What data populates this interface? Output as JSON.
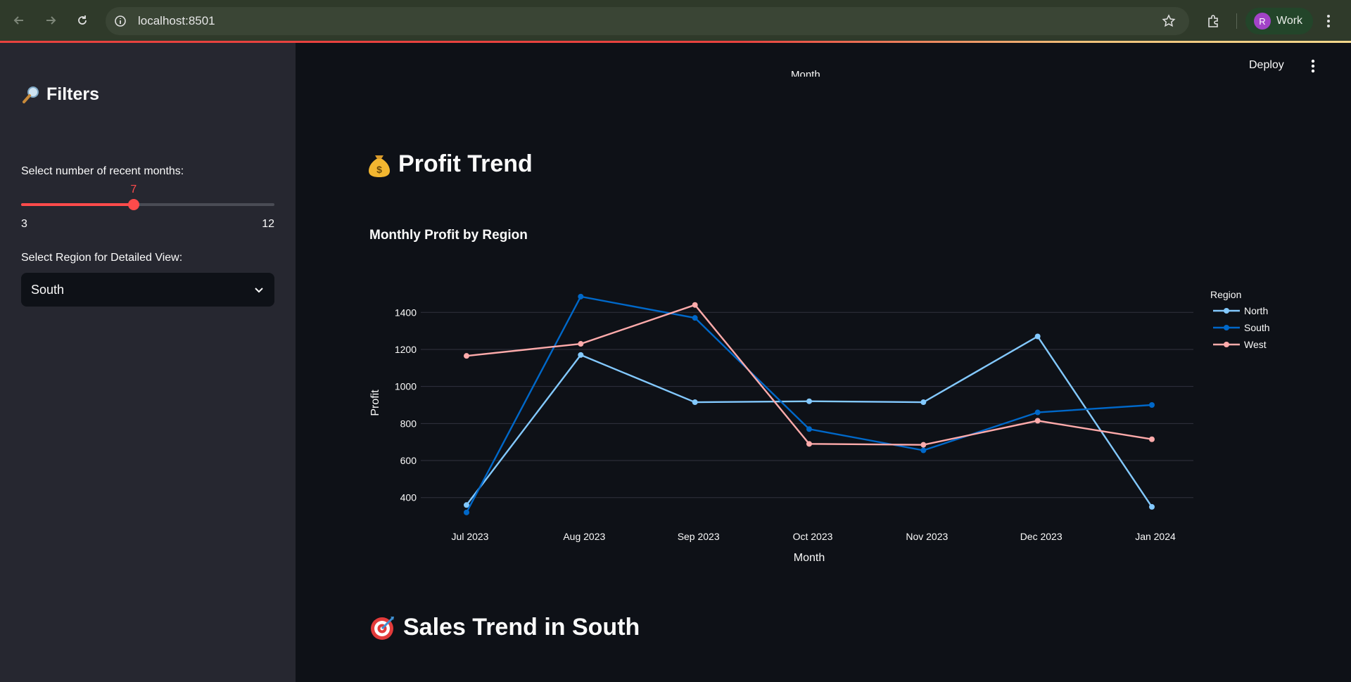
{
  "browser": {
    "url": "localhost:8501",
    "profile_initial": "R",
    "profile_name": "Work"
  },
  "sidebar": {
    "title": "Filters",
    "title_icon": "magnifier-icon",
    "slider": {
      "label": "Select number of recent months:",
      "value": "7",
      "min": "3",
      "max": "12",
      "fraction": 0.444
    },
    "select": {
      "label": "Select Region for Detailed View:",
      "value": "South"
    }
  },
  "header": {
    "deploy_label": "Deploy"
  },
  "main": {
    "partial_axis_label": "Month",
    "profit_section_title": "Profit Trend",
    "profit_section_icon": "money-bag-icon",
    "sales_section_title": "Sales Trend in South",
    "sales_section_icon": "target-icon"
  },
  "chart_data": {
    "type": "line",
    "title": "Monthly Profit by Region",
    "xlabel": "Month",
    "ylabel": "Profit",
    "legend_title": "Region",
    "legend_position": "right",
    "grid": true,
    "categories": [
      "Jul 2023",
      "Aug 2023",
      "Sep 2023",
      "Oct 2023",
      "Nov 2023",
      "Dec 2023",
      "Jan 2024"
    ],
    "yticks": [
      400,
      600,
      800,
      1000,
      1200,
      1400
    ],
    "ylim": [
      270,
      1530
    ],
    "series": [
      {
        "name": "North",
        "color": "#83c9ff",
        "values": [
          360,
          1170,
          915,
          920,
          915,
          1270,
          350
        ]
      },
      {
        "name": "South",
        "color": "#0068c9",
        "values": [
          320,
          1485,
          1370,
          770,
          655,
          860,
          900
        ]
      },
      {
        "name": "West",
        "color": "#ffabab",
        "values": [
          1165,
          1230,
          1440,
          690,
          685,
          815,
          715
        ]
      }
    ]
  }
}
